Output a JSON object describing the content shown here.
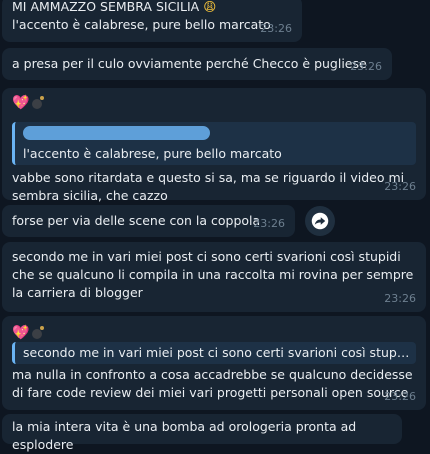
{
  "messages": [
    {
      "quote_text": "MI AMMAZZO SEMBRA SICILIA",
      "text": "l'accento è calabrese, pure bello marcato",
      "time": "23:26"
    },
    {
      "text": "a presa per il culo ovviamente perché Checco è pugliese",
      "time": "23:26"
    },
    {
      "reply_text": "l'accento è calabrese, pure bello marcato",
      "text": "vabbe sono ritardata e questo si sa, ma se riguardo il video mi sembra sicilia, che cazzo",
      "time": "23:26"
    },
    {
      "text": "forse per via delle scene con la coppola",
      "time": "23:26"
    },
    {
      "text": "secondo me in vari miei post ci sono certi svarioni così stupidi che se qualcuno li compila in una raccolta mi rovina per sempre la carriera di blogger",
      "time": "23:26"
    },
    {
      "reply_text": "secondo me in vari miei post ci sono certi svarioni così stupidi ch...",
      "text": "ma nulla in confronto a cosa accadrebbe se qualcuno decidesse di fare code review dei miei vari progetti personali open source",
      "time": "23:26"
    },
    {
      "text": "la mia intera vita è una bomba ad orologeria pronta ad esplodere"
    }
  ],
  "icons": {
    "reaction_heart": "sparkling-heart-icon",
    "reaction_bomb": "bomb-icon",
    "forward": "forward-icon",
    "weary_face": "weary-face-icon"
  },
  "colors": {
    "background": "#0e1621",
    "bubble": "#182533",
    "accent": "#6ab3f3",
    "timestamp": "#6d7f8f"
  }
}
